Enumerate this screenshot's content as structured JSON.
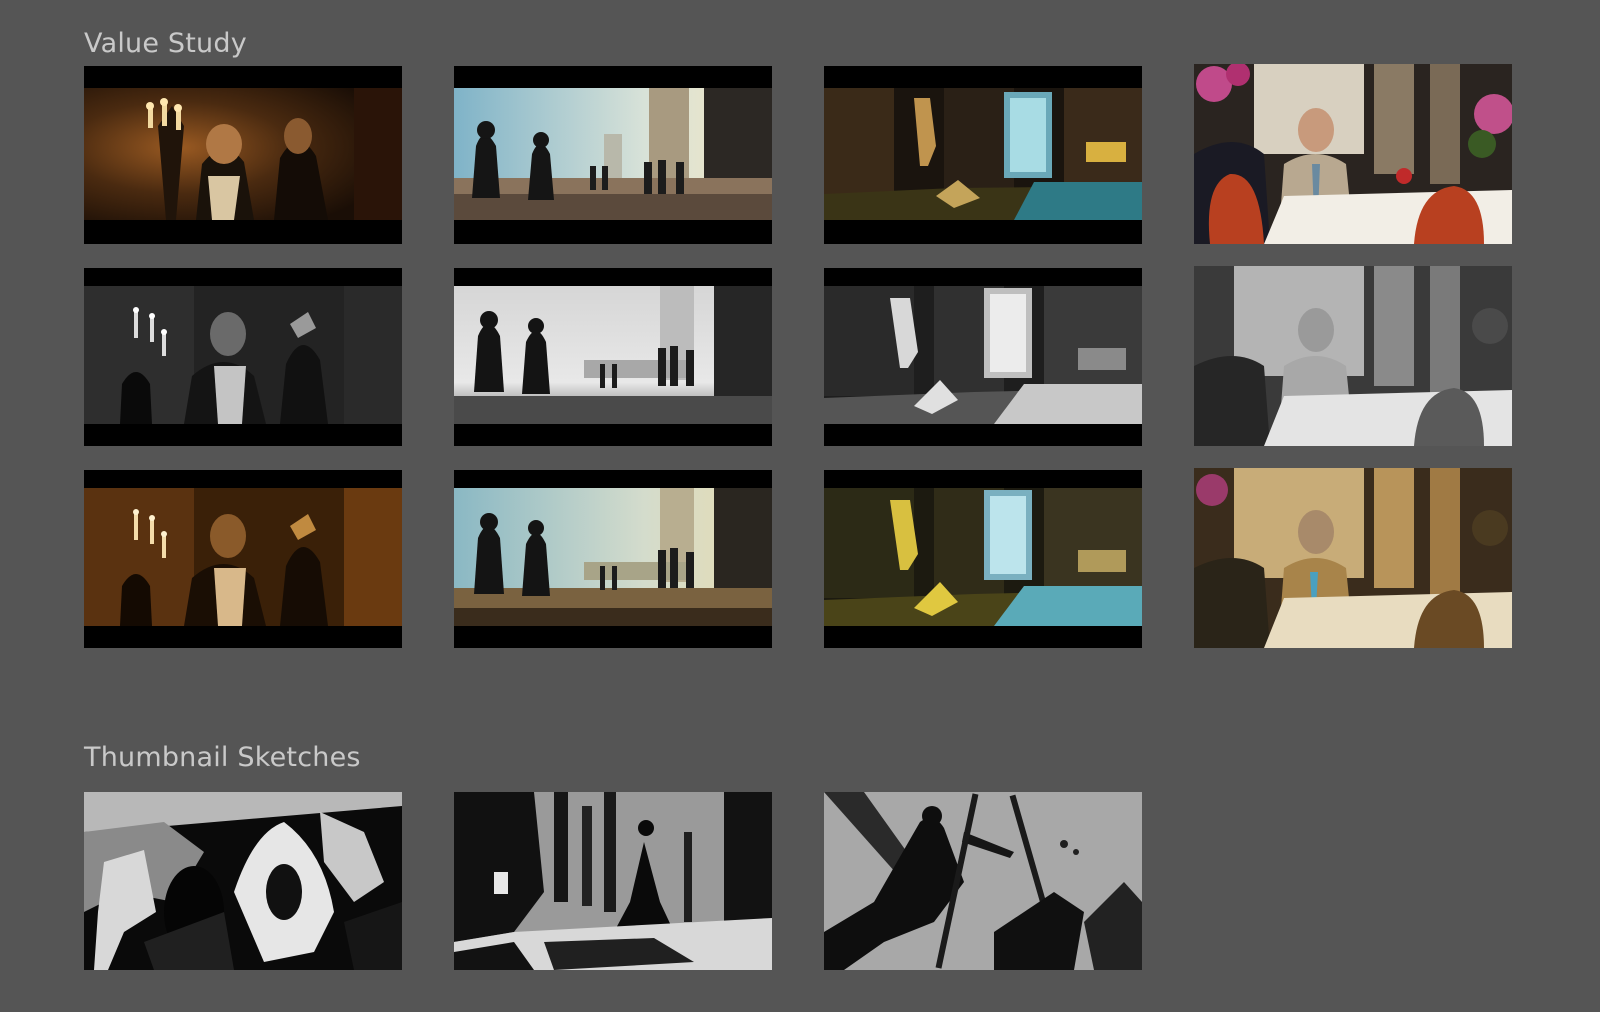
{
  "sections": {
    "value_study": {
      "title": "Value Study"
    },
    "thumbnail_sketches": {
      "title": "Thumbnail Sketches"
    }
  },
  "palette": {
    "page_background": "#555555",
    "heading_text": "#c9c9c9"
  },
  "value_study_columns": [
    "candlelit-interior",
    "city-silhouettes",
    "night-street-window",
    "cafe-terrace"
  ],
  "value_study_rows": [
    "color-reference",
    "grayscale-value-study",
    "color-value-study"
  ]
}
